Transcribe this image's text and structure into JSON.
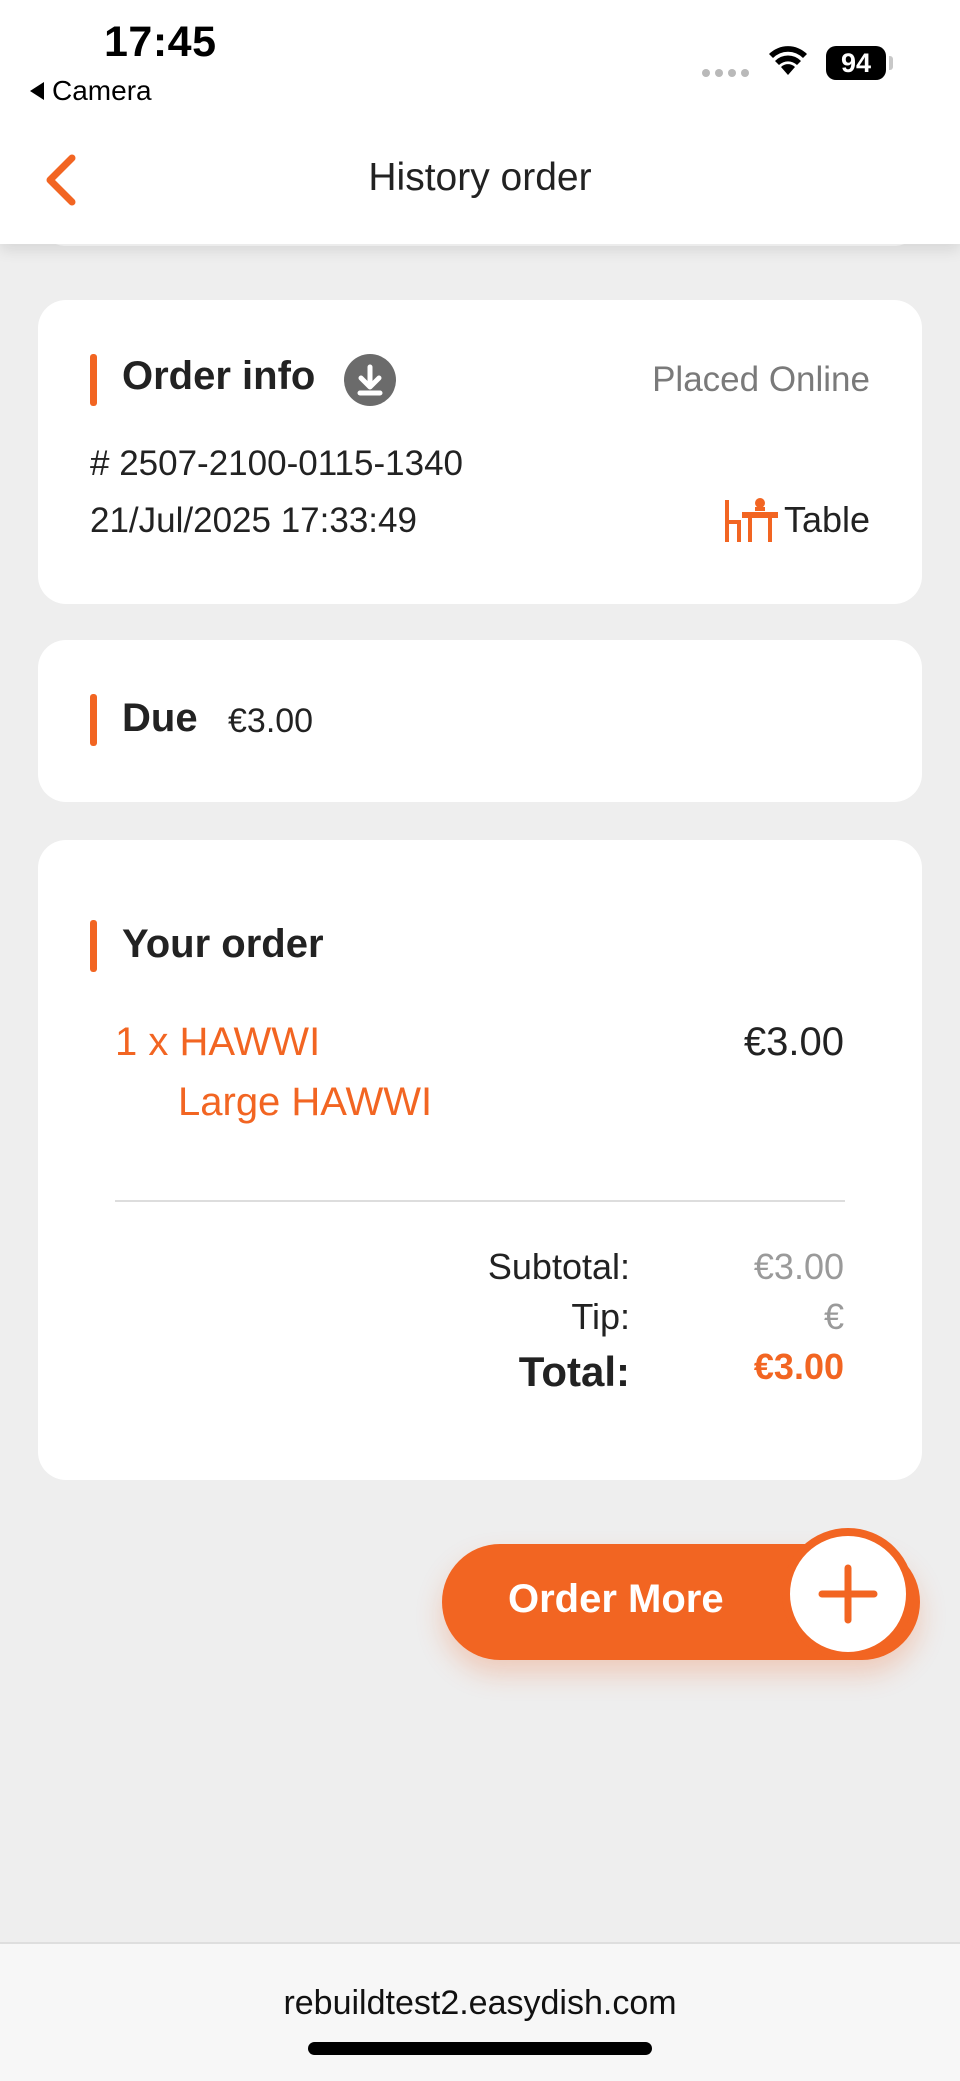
{
  "status_bar": {
    "time": "17:45",
    "back_app": "Camera",
    "battery": "94"
  },
  "header": {
    "title": "History order"
  },
  "order_info": {
    "title": "Order info",
    "source": "Placed Online",
    "order_number": "# 2507-2100-0115-1340",
    "date": "21/Jul/2025 17:33:49",
    "service_type": "Table"
  },
  "due": {
    "label": "Due",
    "amount": "€3.00"
  },
  "your_order": {
    "title": "Your order",
    "items": [
      {
        "line": "1 x HAWWI",
        "option": "Large HAWWI",
        "price": "€3.00"
      }
    ],
    "subtotal_label": "Subtotal:",
    "subtotal_value": "€3.00",
    "tip_label": "Tip:",
    "tip_value": "€",
    "total_label": "Total:",
    "total_value": "€3.00"
  },
  "order_more": {
    "label": "Order More"
  },
  "browser": {
    "url": "rebuildtest2.easydish.com"
  },
  "colors": {
    "accent": "#f26522",
    "background": "#eeeeee",
    "card": "#ffffff"
  },
  "icons": {
    "back": "chevron-left-icon",
    "download": "download-icon",
    "table": "table-chair-icon",
    "add": "plus-icon"
  }
}
